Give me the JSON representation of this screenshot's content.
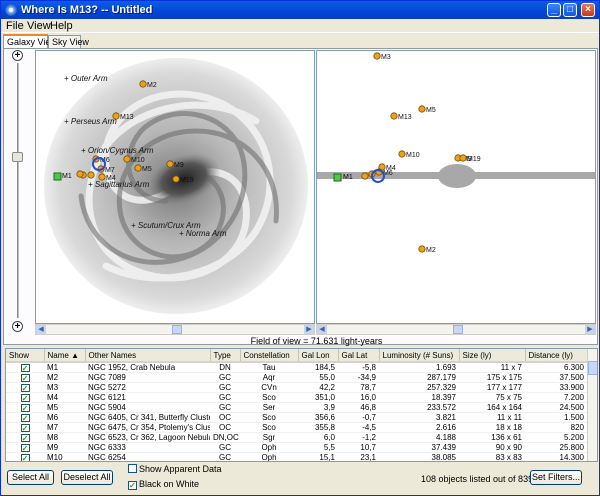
{
  "window": {
    "title": "Where Is M13? -- Untitled"
  },
  "title_buttons": {
    "minimize": "_",
    "maximize": "□",
    "close": "×"
  },
  "menu": [
    "File",
    "View",
    "Help"
  ],
  "tabs": [
    {
      "label": "Galaxy View",
      "active": true
    },
    {
      "label": "Sky View",
      "active": false
    }
  ],
  "zoom": {
    "in": "+",
    "out": "+"
  },
  "galaxy_view": {
    "arm_labels": [
      "+ Outer Arm",
      "+ Perseus Arm",
      "+ Orion/Cygnus Arm",
      "+ Sagittarius Arm",
      "+ Scutum/Crux Arm",
      "+ Norma Arm"
    ],
    "object_labels": [
      "M2",
      "M13",
      "M10",
      "M5",
      "M9",
      "M19",
      "M1",
      "M4",
      "M3",
      "M6",
      "M7"
    ]
  },
  "side_view": {
    "object_labels": [
      "M3",
      "M5",
      "M13",
      "M10",
      "M9",
      "M19",
      "M4",
      "M1",
      "M6",
      "M2"
    ]
  },
  "field_of_view": "Field of view = 71.631 light-years",
  "table": {
    "columns": [
      "Show",
      "Name ▲",
      "Other Names",
      "Type",
      "Constellation",
      "Gal Lon",
      "Gal Lat",
      "Luminosity (# Suns)",
      "Size (ly)",
      "Distance (ly)"
    ],
    "rows": [
      {
        "show": true,
        "name": "M1",
        "other": "NGC 1952,  Crab Nebula",
        "type": "DN",
        "const": "Tau",
        "lon": "184,5",
        "lat": "-5,8",
        "lum": "1.693",
        "size": "11 x 7",
        "dist": "6.300"
      },
      {
        "show": true,
        "name": "M2",
        "other": "NGC 7089",
        "type": "GC",
        "const": "Aqr",
        "lon": "55,0",
        "lat": "-34,9",
        "lum": "287.179",
        "size": "175 x 175",
        "dist": "37.500"
      },
      {
        "show": true,
        "name": "M3",
        "other": "NGC 5272",
        "type": "GC",
        "const": "CVn",
        "lon": "42,2",
        "lat": "78,7",
        "lum": "257.329",
        "size": "177 x 177",
        "dist": "33.900"
      },
      {
        "show": true,
        "name": "M4",
        "other": "NGC 6121",
        "type": "GC",
        "const": "Sco",
        "lon": "351,0",
        "lat": "16,0",
        "lum": "18.397",
        "size": "75 x 75",
        "dist": "7.200"
      },
      {
        "show": true,
        "name": "M5",
        "other": "NGC 5904",
        "type": "GC",
        "const": "Ser",
        "lon": "3,9",
        "lat": "46,8",
        "lum": "233.572",
        "size": "164 x 164",
        "dist": "24.500"
      },
      {
        "show": true,
        "name": "M6",
        "other": "NGC 6405,  Cr 341,  Butterfly Cluster",
        "type": "OC",
        "const": "Sco",
        "lon": "356,6",
        "lat": "-0,7",
        "lum": "3.821",
        "size": "11 x 11",
        "dist": "1.500"
      },
      {
        "show": true,
        "name": "M7",
        "other": "NGC 6475,  Cr 354,  Ptolemy's Cluster",
        "type": "OC",
        "const": "Sco",
        "lon": "355,8",
        "lat": "-4,5",
        "lum": "2.616",
        "size": "18 x 18",
        "dist": "820"
      },
      {
        "show": true,
        "name": "M8",
        "other": "NGC 6523,  Cr 362,  Lagoon Nebula",
        "type": "DN,OC",
        "const": "Sgr",
        "lon": "6,0",
        "lat": "-1,2",
        "lum": "4.188",
        "size": "136 x 61",
        "dist": "5.200"
      },
      {
        "show": true,
        "name": "M9",
        "other": "NGC 6333",
        "type": "GC",
        "const": "Oph",
        "lon": "5,5",
        "lat": "10,7",
        "lum": "37.439",
        "size": "90 x 90",
        "dist": "25.800"
      },
      {
        "show": true,
        "name": "M10",
        "other": "NGC 6254",
        "type": "GC",
        "const": "Oph",
        "lon": "15,1",
        "lat": "23,1",
        "lum": "38.085",
        "size": "83 x 83",
        "dist": "14.300"
      }
    ]
  },
  "buttons": {
    "select_all": "Select All",
    "deselect_all": "Deselect All",
    "set_filters": "Set Filters..."
  },
  "options": {
    "show_apparent": {
      "label": "Show Apparent Data",
      "checked": false
    },
    "black_on_white": {
      "label": "Black on White",
      "checked": true
    }
  },
  "status": "108 objects listed out of 839",
  "colors": {
    "title_blue": "#0246d4",
    "marker_fill": "#e8a317",
    "sun_marker": "#4cc94c",
    "selected_ring": "#1f4fd8"
  }
}
